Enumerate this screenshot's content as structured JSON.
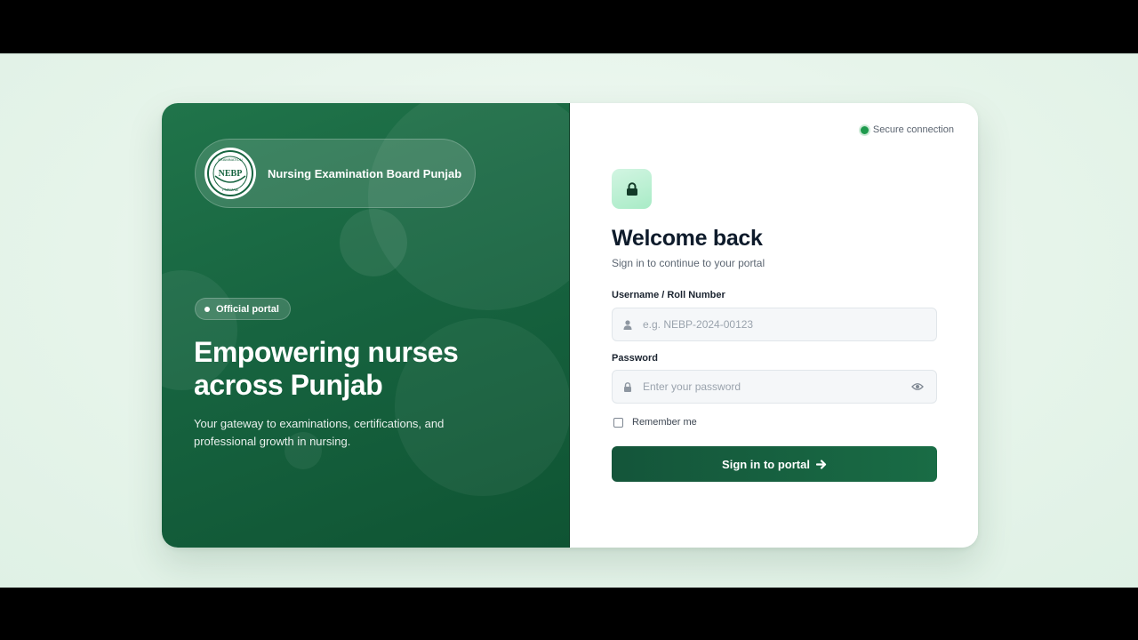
{
  "brand": {
    "name": "Nursing Examination Board Punjab",
    "logo_text": "NEBP",
    "logo_ring_top": "EXAMINATION",
    "logo_ring_bottom": "PUNJAB"
  },
  "hero": {
    "badge": "Official portal",
    "headline_line1": "Empowering nurses",
    "headline_line2": "across Punjab",
    "tagline": "Your gateway to examinations, certifications, and professional growth in nursing."
  },
  "login": {
    "secure_label": "Secure connection",
    "title": "Welcome back",
    "subtitle": "Sign in to continue to your portal",
    "username_label": "Username / Roll Number",
    "username_placeholder": "e.g. NEBP-2024-00123",
    "password_label": "Password",
    "password_placeholder": "Enter your password",
    "remember_label": "Remember me",
    "submit_label": "Sign in to portal"
  },
  "icons": {
    "lock": "lock-icon",
    "user": "user-icon",
    "password_lock": "lock-icon",
    "eye": "eye-icon",
    "arrow": "arrow-right-icon"
  },
  "colors": {
    "brand_green": "#176440",
    "button_green": "#14553a",
    "secure_dot": "#1e9a4d",
    "lock_tile": "#b8efd0"
  }
}
